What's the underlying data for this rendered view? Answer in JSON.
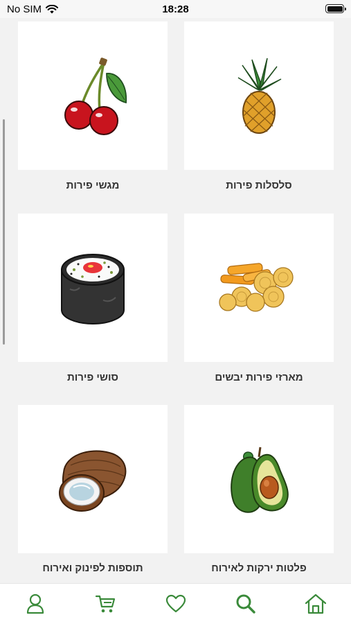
{
  "status_bar": {
    "carrier": "No SIM",
    "time": "18:28"
  },
  "categories": [
    {
      "label": "סלסלות פירות",
      "icon": "pineapple-icon"
    },
    {
      "label": "מגשי פירות",
      "icon": "cherries-icon"
    },
    {
      "label": "מארזי פירות יבשים",
      "icon": "dried-fruit-icon"
    },
    {
      "label": "סושי פירות",
      "icon": "sushi-roll-icon"
    },
    {
      "label": "פלטות ירקות לאירוח",
      "icon": "avocado-icon"
    },
    {
      "label": "תוספות לפינוק ואירוח",
      "icon": "coconut-icon"
    }
  ],
  "tab_bar": {
    "items": [
      "profile-icon",
      "cart-icon",
      "heart-icon",
      "search-icon",
      "home-icon"
    ],
    "color": "#3a8a3a"
  }
}
